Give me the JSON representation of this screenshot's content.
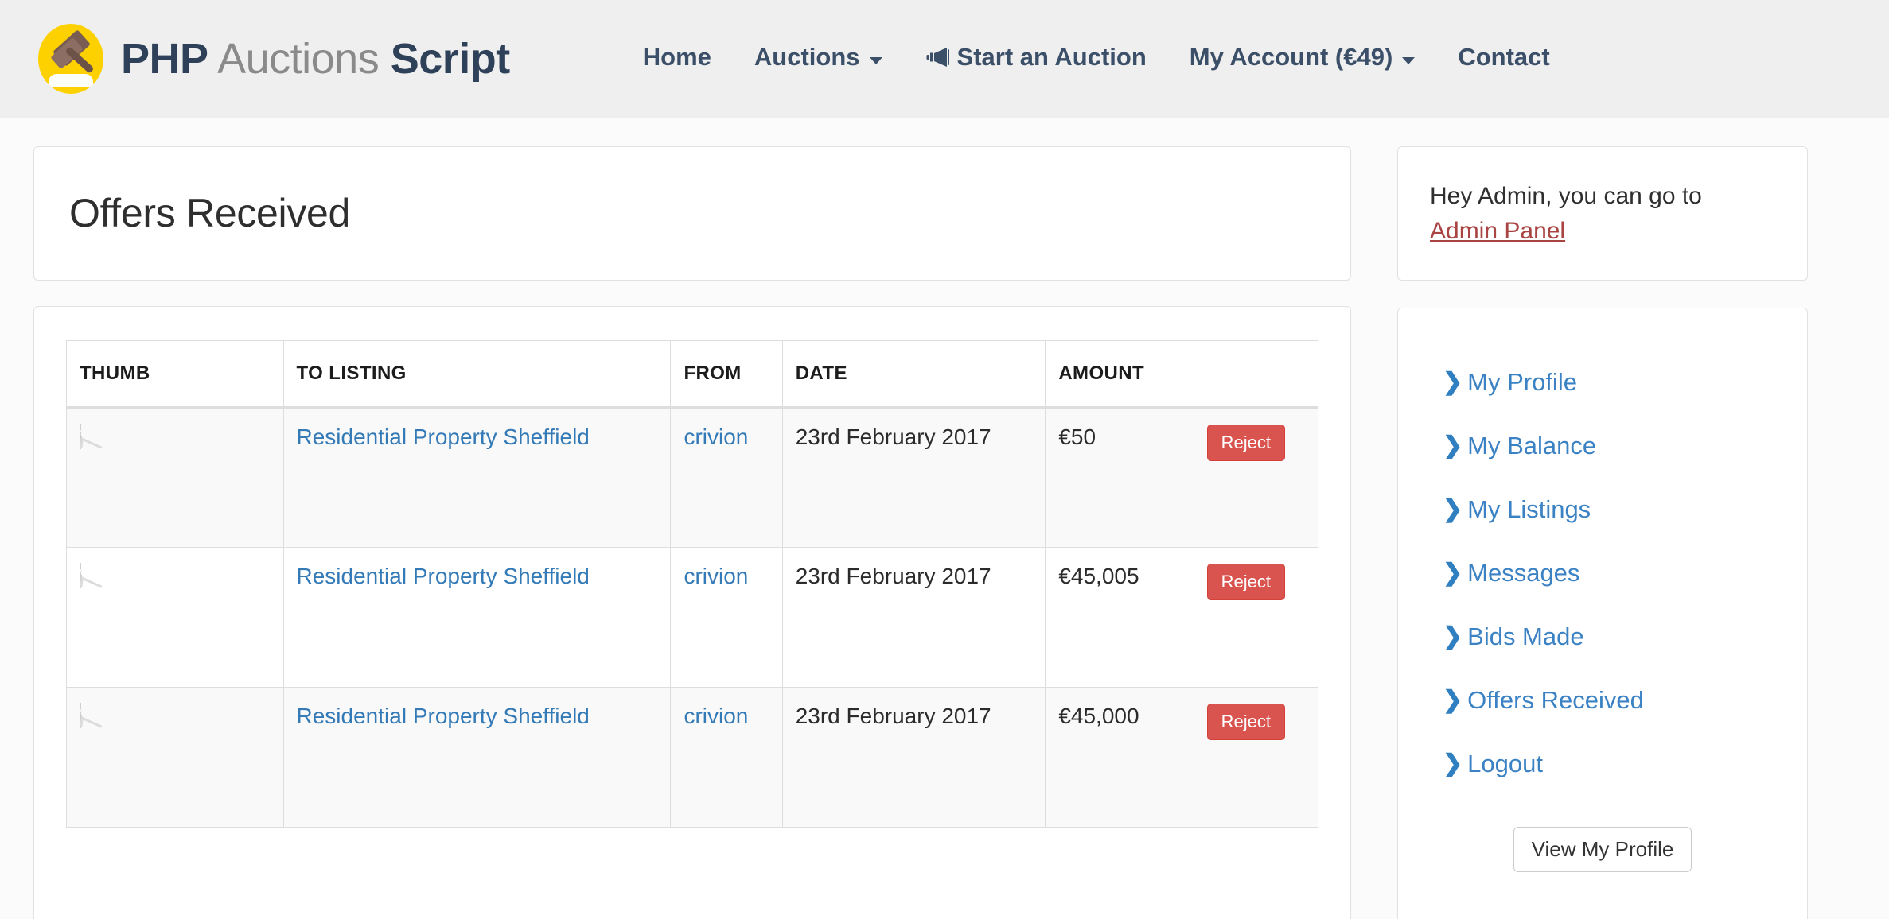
{
  "brand": {
    "part1": "PHP",
    "part2": "Auctions",
    "part3": "Script",
    "logo_icon": "gavel-icon"
  },
  "nav": {
    "items": [
      {
        "label": "Home",
        "caret": false,
        "icon": null
      },
      {
        "label": "Auctions",
        "caret": true,
        "icon": null
      },
      {
        "label": "Start an Auction",
        "caret": false,
        "icon": "bullhorn-icon"
      },
      {
        "label": "My Account (€49)",
        "caret": true,
        "icon": null
      },
      {
        "label": "Contact",
        "caret": false,
        "icon": null
      }
    ]
  },
  "page": {
    "title": "Offers Received"
  },
  "table": {
    "columns": [
      "THUMB",
      "TO LISTING",
      "FROM",
      "DATE",
      "AMOUNT",
      ""
    ],
    "rows": [
      {
        "thumb_alt": "house-thumbnail",
        "listing": "Residential Property Sheffield",
        "from": "crivion",
        "date": "23rd February 2017",
        "amount": "€50",
        "action": "Reject"
      },
      {
        "thumb_alt": "house-thumbnail",
        "listing": "Residential Property Sheffield",
        "from": "crivion",
        "date": "23rd February 2017",
        "amount": "€45,005",
        "action": "Reject"
      },
      {
        "thumb_alt": "house-thumbnail",
        "listing": "Residential Property Sheffield",
        "from": "crivion",
        "date": "23rd February 2017",
        "amount": "€45,000",
        "action": "Reject"
      }
    ]
  },
  "sidebar": {
    "greeting_prefix": "Hey Admin, you can go to",
    "admin_link": "Admin Panel",
    "menu": [
      {
        "label": "My Profile"
      },
      {
        "label": "My Balance"
      },
      {
        "label": "My Listings"
      },
      {
        "label": "Messages"
      },
      {
        "label": "Bids Made"
      },
      {
        "label": "Offers Received"
      },
      {
        "label": "Logout"
      }
    ],
    "profile_button": "View My Profile"
  },
  "colors": {
    "header_bg": "#efefef",
    "brand_dark": "#2f4159",
    "brand_grey": "#8a8a8a",
    "logo_yellow": "#fdd100",
    "link_blue": "#337ab7",
    "sidebar_link_blue": "#3b82c4",
    "danger_red": "#d9534f",
    "admin_link_red": "#a94442",
    "page_bg": "#fbfbfb"
  }
}
